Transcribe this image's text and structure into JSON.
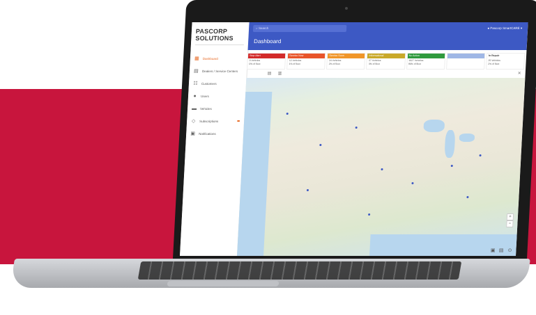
{
  "app": {
    "logo": "PASCORP SOLUTIONS",
    "search_placeholder": "Search",
    "user": "Pascorp SmartCARE",
    "page_title": "Dashboard"
  },
  "sidebar": {
    "items": [
      {
        "label": "Dashboard",
        "icon": "dashboard-icon",
        "active": true
      },
      {
        "label": "Dealers / Service Centers",
        "icon": "building-icon"
      },
      {
        "label": "Customers",
        "icon": "customers-icon"
      },
      {
        "label": "Users",
        "icon": "user-icon"
      },
      {
        "label": "Vehicles",
        "icon": "truck-icon"
      },
      {
        "label": "Subscriptions",
        "icon": "subscriptions-icon",
        "badge": ""
      },
      {
        "label": "Notifications",
        "icon": "bell-icon"
      }
    ]
  },
  "cards": [
    {
      "title": "Stop Alert",
      "color": "#d22a2a",
      "line1": "0 Vehicles",
      "line2": "0% of fleet"
    },
    {
      "title": "Service Now",
      "color": "#e8542a",
      "line1": "12 Vehicles",
      "line2": "1% of fleet"
    },
    {
      "title": "Service Soon",
      "color": "#f0962a",
      "line1": "24 Vehicles",
      "line2": "2% of fleet"
    },
    {
      "title": "Informational",
      "color": "#c9a92a",
      "line1": "27 Vehicles",
      "line2": "3% of fleet"
    },
    {
      "title": "No Action",
      "color": "#2f9a3e",
      "line1": "1027 Vehicles",
      "line2": "86% of fleet"
    },
    {
      "title": "",
      "color": "#9fb7e5",
      "line1": "",
      "line2": ""
    },
    {
      "title": "In Repair",
      "color": "#ffffff",
      "line1": "25 Vehicles",
      "line2": "2% of fleet"
    }
  ],
  "colors": {
    "primary": "#3d59c4",
    "accent": "#e86a25",
    "background_band": "#c8153d"
  }
}
